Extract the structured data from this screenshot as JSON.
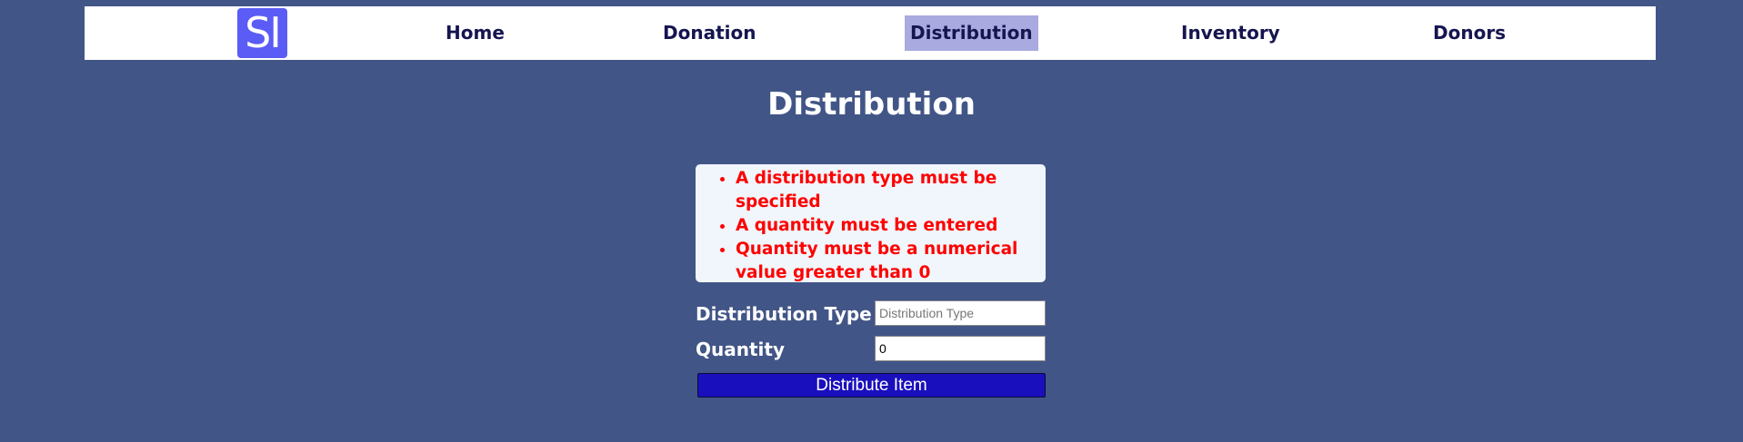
{
  "nav": {
    "logo_text": "SI",
    "items": [
      {
        "label": "Home"
      },
      {
        "label": "Donation"
      },
      {
        "label": "Distribution"
      },
      {
        "label": "Inventory"
      },
      {
        "label": "Donors"
      }
    ],
    "active_item": "Distribution"
  },
  "page": {
    "title": "Distribution"
  },
  "errors": [
    "A distribution type must be specified",
    "A quantity must be entered",
    "Quantity must be a numerical value greater than 0"
  ],
  "form": {
    "distribution_type": {
      "label": "Distribution Type",
      "placeholder": "Distribution Type",
      "value": ""
    },
    "quantity": {
      "label": "Quantity",
      "value": "0"
    },
    "submit_label": "Distribute Item"
  },
  "colors": {
    "background": "#425587",
    "navbar": "#ffffff",
    "nav_text": "#151550",
    "nav_active_bg": "#a9aae0",
    "logo_bg": "#5a5cf5",
    "error_box_bg": "#f0f6fc",
    "error_text": "#ff0000",
    "button_bg": "#1a0fbd"
  }
}
